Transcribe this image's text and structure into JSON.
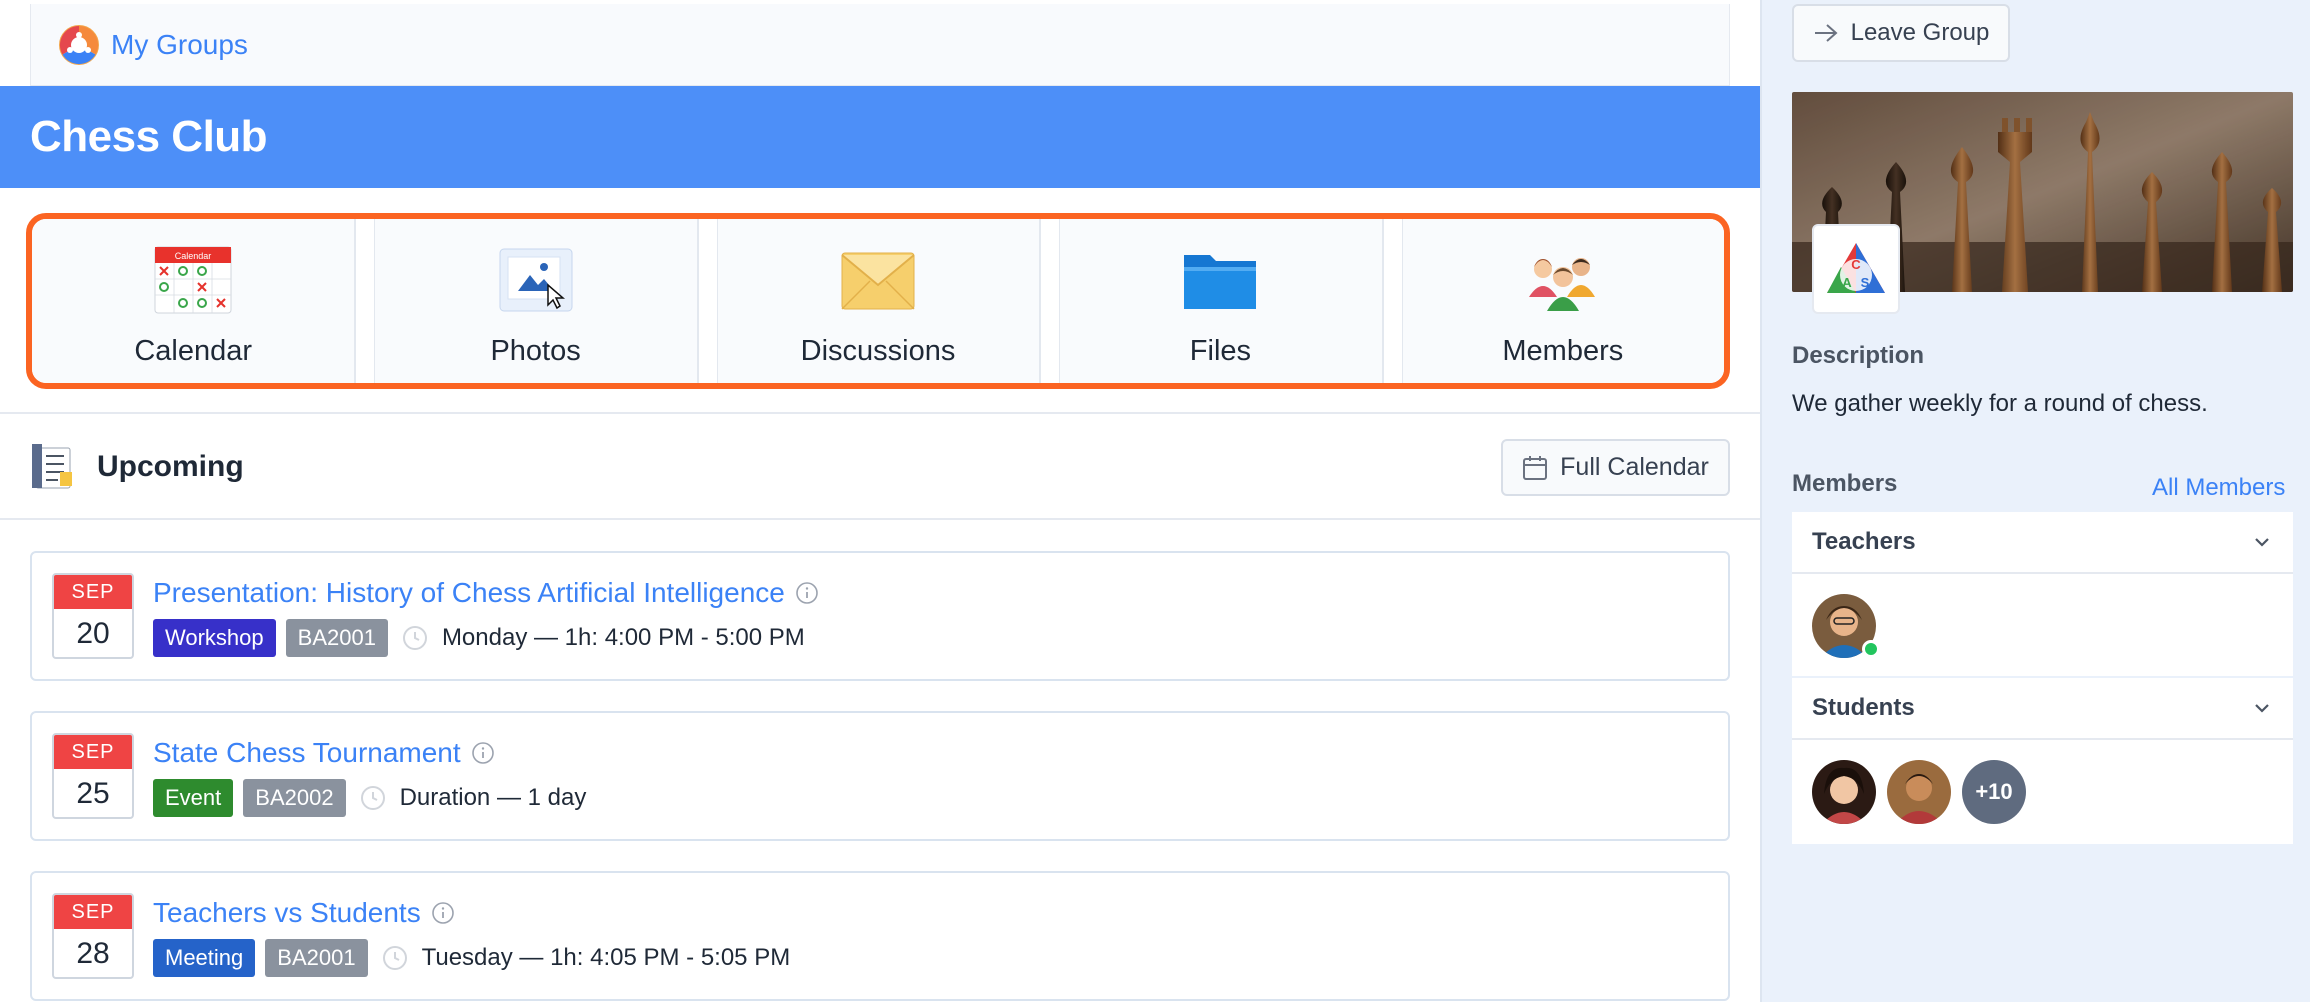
{
  "breadcrumb": {
    "label": "My Groups"
  },
  "group": {
    "title": "Chess Club"
  },
  "tools": [
    {
      "label": "Calendar",
      "icon": "calendar-icon",
      "icon_text": "Calendar"
    },
    {
      "label": "Photos",
      "icon": "photos-icon"
    },
    {
      "label": "Discussions",
      "icon": "envelope-icon"
    },
    {
      "label": "Files",
      "icon": "folder-icon"
    },
    {
      "label": "Members",
      "icon": "members-icon"
    }
  ],
  "upcoming": {
    "title": "Upcoming",
    "full_calendar_label": "Full Calendar"
  },
  "events": [
    {
      "month": "SEP",
      "day": "20",
      "title": "Presentation: History of Chess Artificial Intelligence",
      "type": "Workshop",
      "type_color": "#3730c9",
      "room": "BA2001",
      "time": "Monday — 1h: 4:00 PM - 5:00 PM"
    },
    {
      "month": "SEP",
      "day": "25",
      "title": "State Chess Tournament",
      "type": "Event",
      "type_color": "#2e8b2e",
      "room": "BA2002",
      "time": "Duration — 1 day"
    },
    {
      "month": "SEP",
      "day": "28",
      "title": "Teachers vs Students",
      "type": "Meeting",
      "type_color": "#2563c9",
      "room": "BA2001",
      "time": "Tuesday — 1h: 4:05 PM - 5:05 PM"
    }
  ],
  "sidebar": {
    "leave_label": "Leave Group",
    "logo_letters": [
      "C",
      "A",
      "S"
    ],
    "description_heading": "Description",
    "description": "We gather weekly for a round of chess.",
    "members_heading": "Members",
    "all_members_label": "All Members",
    "teachers_label": "Teachers",
    "students_label": "Students",
    "more_count": "+10"
  },
  "colors": {
    "banner": "#4d8ff8",
    "highlight_frame": "#fb6422",
    "link": "#3b82f6",
    "room_tag": "#8a929e",
    "date_month": "#ef4444",
    "online": "#22c55e"
  }
}
